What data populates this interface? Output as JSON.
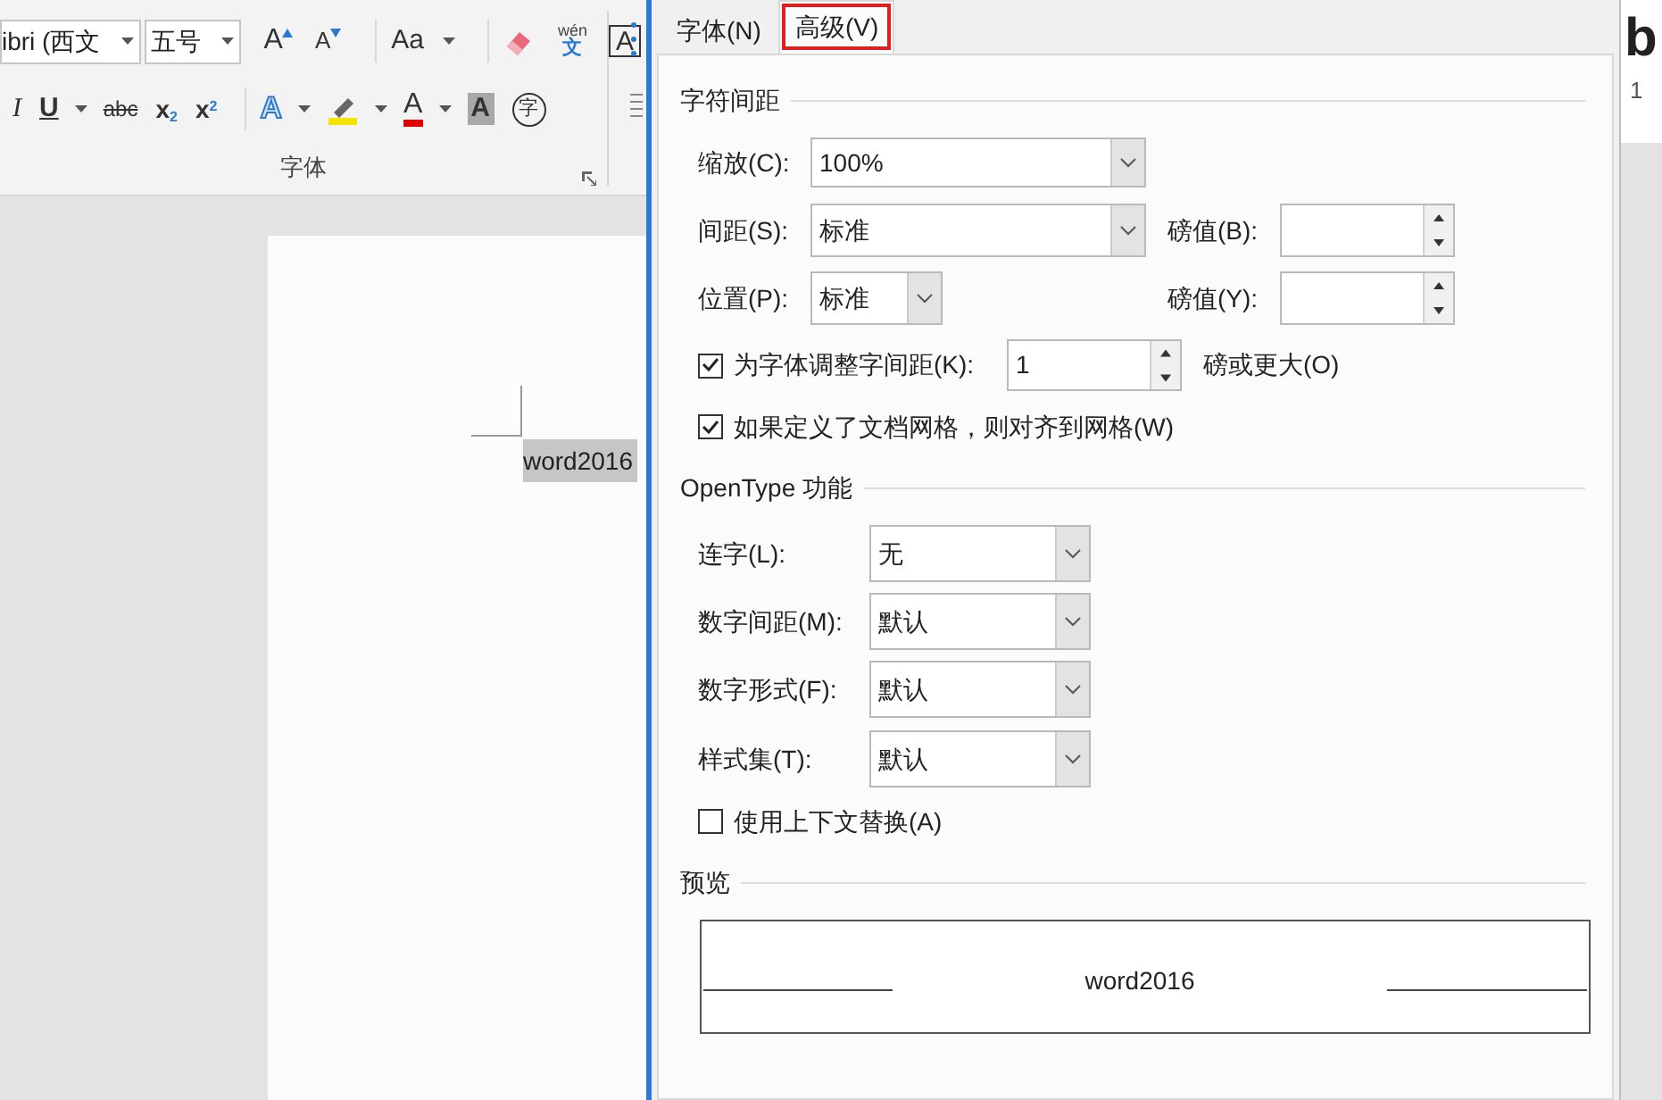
{
  "ribbon": {
    "font_name": "ibri (西文",
    "font_size": "五号",
    "row_1": [
      {
        "kind": "grow",
        "text": "A"
      },
      {
        "kind": "shrink",
        "text": "A"
      },
      {
        "kind": "case",
        "text": "Aa"
      },
      {
        "kind": "eraser"
      },
      {
        "kind": "phonetic",
        "text": "wén",
        "sub": "文"
      },
      {
        "kind": "border",
        "text": "A"
      }
    ],
    "row_2": [
      {
        "kind": "italic",
        "text": "I"
      },
      {
        "kind": "underline",
        "text": "U"
      },
      {
        "kind": "strike",
        "text": "abc"
      },
      {
        "kind": "subscript",
        "text": "x",
        "script": "2"
      },
      {
        "kind": "superscript",
        "text": "x",
        "script": "2"
      },
      {
        "kind": "effects",
        "text": "A"
      },
      {
        "kind": "highlight"
      },
      {
        "kind": "fontcolor",
        "text": "A"
      },
      {
        "kind": "shading",
        "text": "A"
      },
      {
        "kind": "enclose",
        "text": "字"
      }
    ],
    "group_label": "字体",
    "styles_preview": {
      "text": "b",
      "caption": "1"
    }
  },
  "document": {
    "text": "word2016"
  },
  "dialog": {
    "tabs": [
      {
        "label": "字体(N)",
        "selected": false,
        "highlighted": false
      },
      {
        "label": "高级(V)",
        "selected": true,
        "highlighted": true
      }
    ],
    "spacing": {
      "title": "字符间距",
      "rows": [
        {
          "kind": "dropdown",
          "label": "缩放(C):",
          "value": "100%",
          "wide": true
        },
        {
          "kind": "dropdown",
          "label": "间距(S):",
          "value": "标准",
          "wide": true,
          "spin_label": "磅值(B):"
        },
        {
          "kind": "dropdown",
          "label": "位置(P):",
          "value": "标准",
          "wide": false,
          "spin_label": "磅值(Y):"
        },
        {
          "kind": "checkspin",
          "label": "为字体调整字间距(K):",
          "checked": true,
          "value": "1",
          "suffix": "磅或更大(O)"
        },
        {
          "kind": "checkbox",
          "label": "如果定义了文档网格，则对齐到网格(W)",
          "checked": true
        }
      ]
    },
    "opentype": {
      "title": "OpenType 功能",
      "rows": [
        {
          "kind": "dropdown",
          "label": "连字(L):",
          "value": "无"
        },
        {
          "kind": "dropdown",
          "label": "数字间距(M):",
          "value": "默认"
        },
        {
          "kind": "dropdown",
          "label": "数字形式(F):",
          "value": "默认"
        },
        {
          "kind": "dropdown",
          "label": "样式集(T):",
          "value": "默认"
        },
        {
          "kind": "checkbox",
          "label": "使用上下文替换(A)",
          "checked": false
        }
      ]
    },
    "preview": {
      "title": "预览",
      "text": "word2016"
    }
  }
}
